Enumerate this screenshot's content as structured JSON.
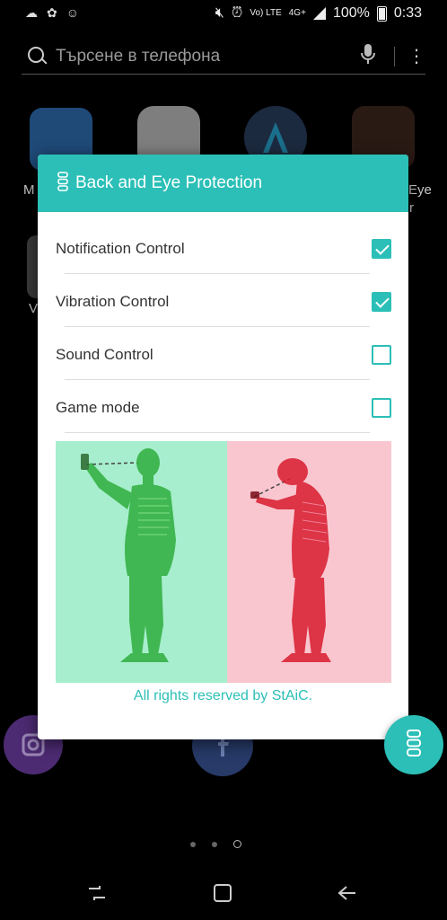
{
  "status_bar": {
    "lte_label": "Vo) LTE",
    "net_label": "4G+",
    "battery": "100%",
    "time": "0:33"
  },
  "search": {
    "placeholder": "Търсене в телефона"
  },
  "background": {
    "labels": [
      "M",
      "Eye",
      "r",
      "V"
    ],
    "app_icons": [
      "video-app-icon",
      "emag-app-icon",
      "a-app-icon",
      "spine-app-icon",
      "gray-app-icon",
      "instagram-app-icon",
      "facebook-app-icon"
    ]
  },
  "dialog": {
    "title": "Back and Eye Protection",
    "options": [
      {
        "label": "Notification Control",
        "checked": true
      },
      {
        "label": "Vibration Control",
        "checked": true
      },
      {
        "label": "Sound Control",
        "checked": false
      },
      {
        "label": "Game mode",
        "checked": false
      }
    ],
    "footer": "All rights reserved by StAiC.",
    "colors": {
      "accent": "#2bbfb7",
      "good_posture_bg": "#a6eecd",
      "bad_posture_bg": "#f9c6cf"
    }
  },
  "page_indicator": {
    "count": 3,
    "active": 3
  }
}
